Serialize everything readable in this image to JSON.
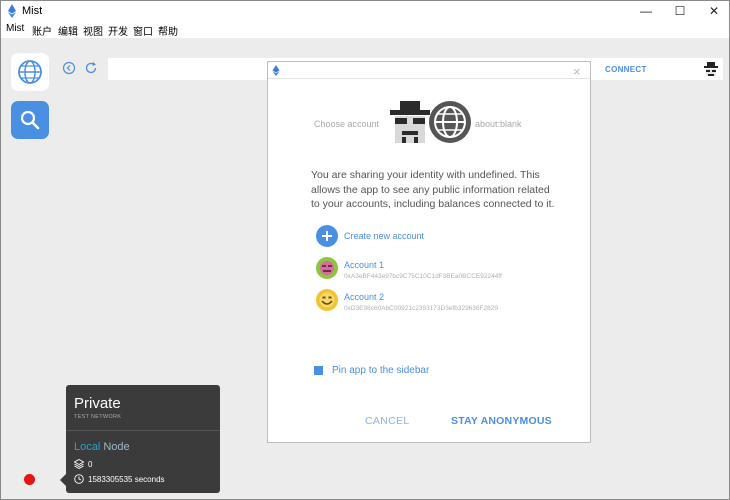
{
  "window": {
    "title": "Mist",
    "controls": {
      "minimize": "—",
      "maximize": "☐",
      "close": "✕"
    }
  },
  "menu": [
    "Mist",
    "账户",
    "编辑",
    "视图",
    "开发",
    "窗口",
    "帮助"
  ],
  "sidebar": {
    "items": [
      {
        "name": "browser",
        "icon": "globe-icon"
      },
      {
        "name": "search",
        "icon": "search-icon"
      }
    ]
  },
  "browser": {
    "url": "",
    "connect_label": "CONNECT"
  },
  "modal": {
    "choose_account": "Choose account",
    "about_blank": "about:blank",
    "share_text": "You are sharing your identity with undefined. This allows the app to see any public information related to your accounts, including balances connected to it.",
    "create_account": "Create new account",
    "accounts": [
      {
        "name": "Account 1",
        "address": "0xA3eBF443e97bc9C75C10C1dF3BEa0BCCE92244ff"
      },
      {
        "name": "Account 2",
        "address": "0xD3E98c60AbC00921c2393173D3efb329636F2829"
      }
    ],
    "pin_label": "Pin app to the sidebar",
    "pin_checked": true,
    "cancel_label": "CANCEL",
    "anonymous_label": "STAY ANONYMOUS"
  },
  "network": {
    "name": "Private",
    "subtitle": "TEST NETWORK",
    "node_local": "Local",
    "node_suffix": " Node",
    "peers": "0",
    "time": "1583305535 seconds",
    "status_color": "#e8140e"
  },
  "colors": {
    "accent": "#4a90e2",
    "sidebar_bg": "#ececec",
    "panel_bg": "#3b3b3b"
  }
}
